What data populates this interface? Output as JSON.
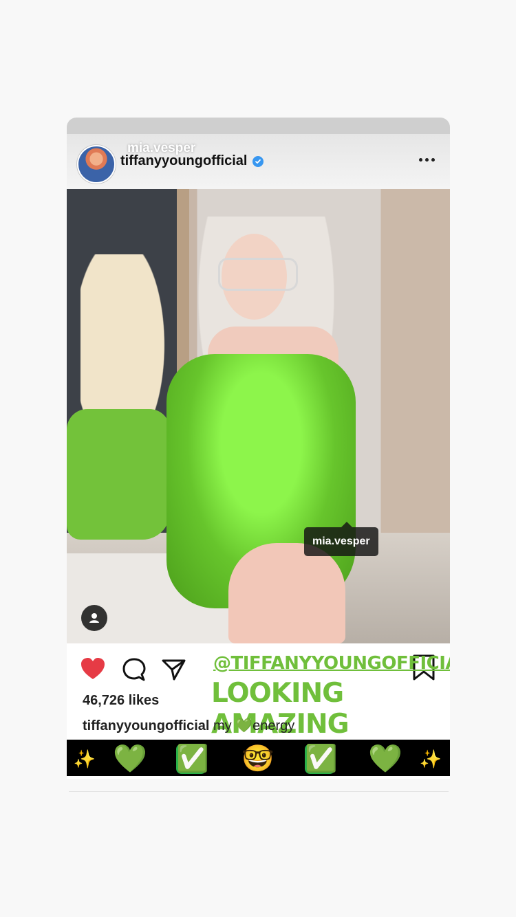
{
  "post": {
    "story_username": "mia.vesper",
    "username": "tiffanyyoungofficial",
    "more_icon": "more-horizontal-icon",
    "verified_icon": "verified-badge-icon"
  },
  "photo": {
    "tag_label": "mia.vesper",
    "tag_icon": "person-icon"
  },
  "actions": {
    "like_icon": "heart-icon",
    "comment_icon": "comment-icon",
    "share_icon": "share-icon",
    "save_icon": "bookmark-icon"
  },
  "sticker": {
    "handle": "@TIFFANYYOUNGOFFICIAL",
    "note": "LOOKING AMAZING",
    "color": "#70bf3b"
  },
  "meta": {
    "likes": "46,726 likes",
    "caption_user": "tiffanyyoungofficial",
    "caption_text": " my 💚energy"
  },
  "emoji_strip": {
    "items": [
      "✨",
      "💚",
      "✅",
      "🤓",
      "✅",
      "💚",
      "✨"
    ]
  }
}
